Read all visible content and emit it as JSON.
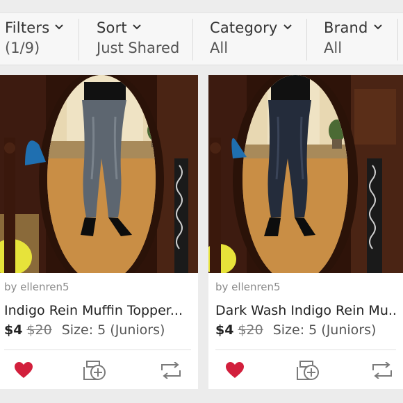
{
  "filters": [
    {
      "label": "Filters",
      "value": "(1/9)"
    },
    {
      "label": "Sort",
      "value": "Just Shared"
    },
    {
      "label": "Category",
      "value": "All"
    },
    {
      "label": "Brand",
      "value": "All"
    }
  ],
  "listings": [
    {
      "seller": "by ellenren5",
      "title": "Indigo Rein Muffin Topper...",
      "price": "$4",
      "original_price": "$20",
      "size": "Size: 5 (Juniors)",
      "jeans_color": "#5d6670"
    },
    {
      "seller": "by ellenren5",
      "title": "Dark Wash Indigo Rein Mu...",
      "price": "$4",
      "original_price": "$20",
      "size": "Size: 5 (Juniors)",
      "jeans_color": "#242c3b"
    }
  ],
  "colors": {
    "like": "#d21f3c",
    "icon": "#7a7a7a",
    "wood": "#3b1a10",
    "floor": "#c98e45",
    "curtain": "#efe3c4"
  },
  "icons": {
    "like": "heart-icon",
    "bundle": "add-to-bundle-icon",
    "share": "share-icon",
    "dropdown": "chevron-down-icon"
  }
}
